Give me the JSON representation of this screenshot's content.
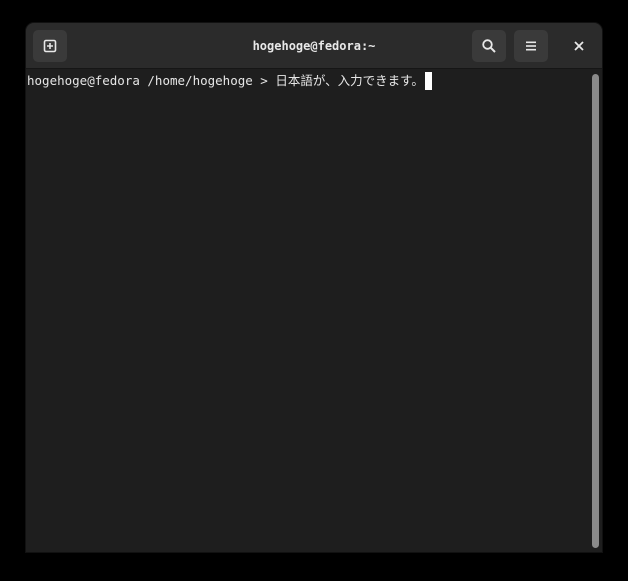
{
  "window": {
    "title": "hogehoge@fedora:~"
  },
  "header": {
    "new_tab_icon": "new-tab-icon",
    "search_icon": "search-icon",
    "menu_icon": "hamburger-menu-icon",
    "close_icon": "close-icon"
  },
  "terminal": {
    "prompt": "hogehoge@fedora /home/hogehoge > ",
    "input": "日本語が、入力できます。"
  },
  "colors": {
    "background": "#1e1e1e",
    "headerbar": "#2b2b2b",
    "text": "#e6e6e6",
    "cursor": "#ffffff"
  }
}
